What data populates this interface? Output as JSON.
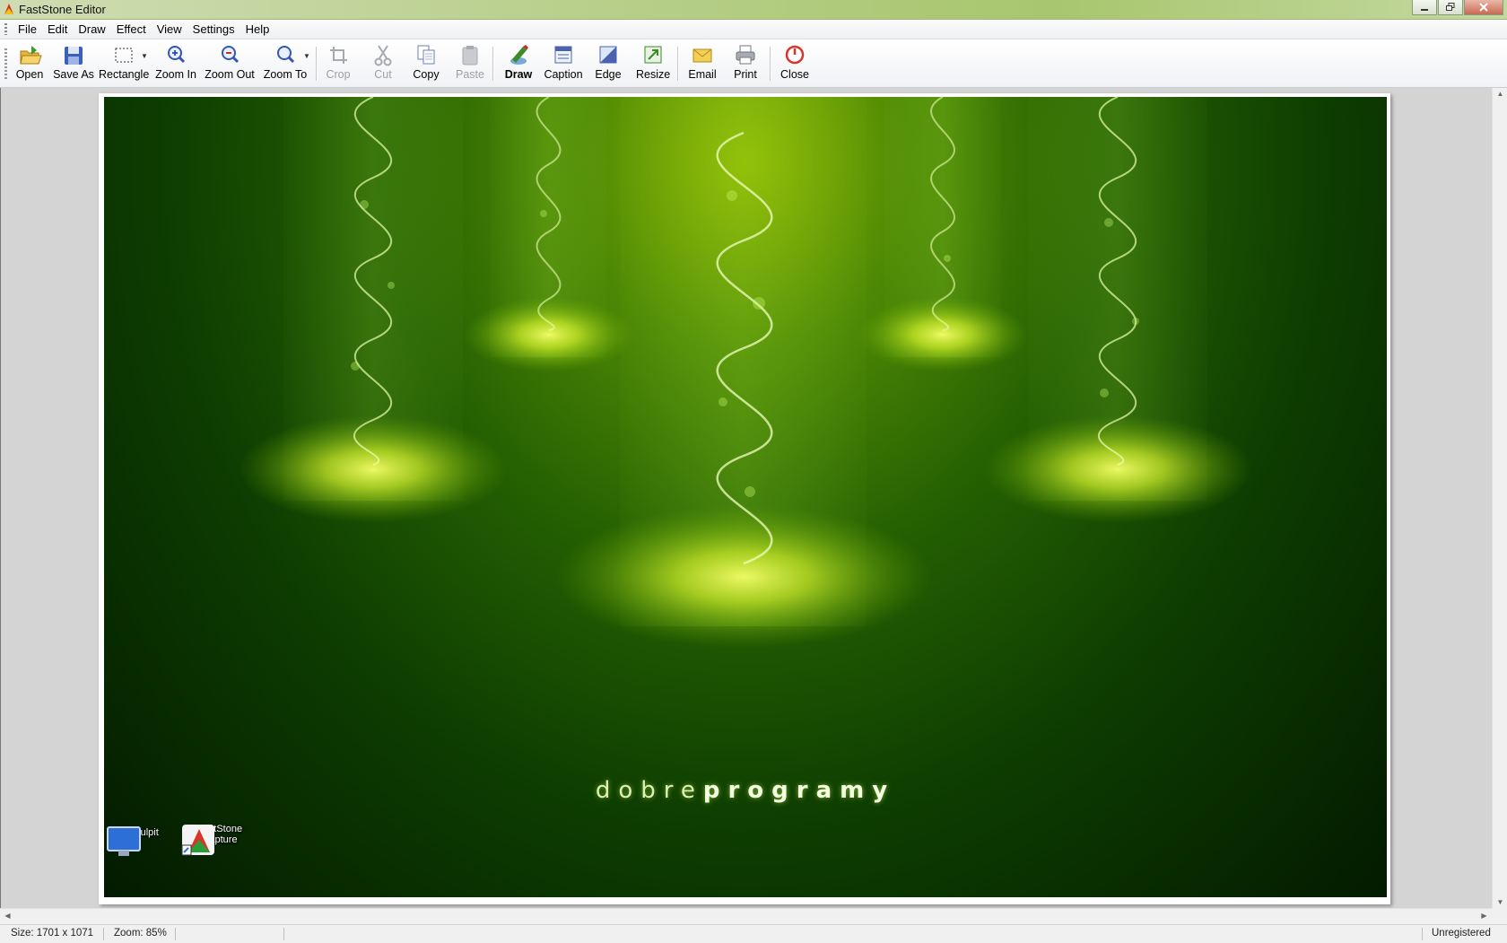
{
  "window": {
    "title": "FastStone Editor",
    "minimize": "0",
    "restore": "1",
    "close": "r"
  },
  "menu": [
    "File",
    "Edit",
    "Draw",
    "Effect",
    "View",
    "Settings",
    "Help"
  ],
  "toolbar": {
    "open": "Open",
    "save_as": "Save As",
    "rectangle": "Rectangle",
    "zoom_in": "Zoom In",
    "zoom_out": "Zoom Out",
    "zoom_to": "Zoom To",
    "crop": "Crop",
    "cut": "Cut",
    "copy": "Copy",
    "paste": "Paste",
    "draw": "Draw",
    "caption": "Caption",
    "edge": "Edge",
    "resize": "Resize",
    "email": "Email",
    "print": "Print",
    "close": "Close"
  },
  "image": {
    "brand_light": "dobre",
    "brand_bold": "programy",
    "desktop_icons": [
      "Pulpit",
      "FastStone Capture"
    ]
  },
  "status": {
    "size": "Size: 1701 x 1071",
    "zoom": "Zoom: 85%",
    "registration": "Unregistered"
  },
  "colors": {
    "accent_green": "#8db600",
    "close_red": "#d9342b"
  }
}
